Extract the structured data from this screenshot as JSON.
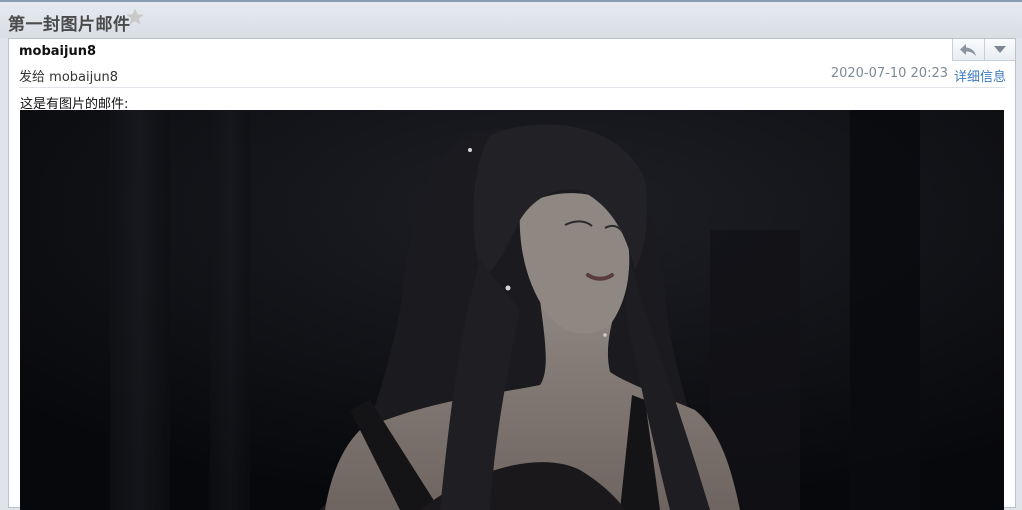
{
  "mail": {
    "subject": "第一封图片邮件",
    "sender": "mobaijun8",
    "to_label": "发给",
    "recipient": "mobaijun8",
    "date": "2020-07-10 20:23",
    "details_link": "详细信息",
    "body_text": "这是有图片的邮件:"
  },
  "icons": {
    "star": "star-icon",
    "reply": "reply-icon",
    "more": "dropdown-arrow-icon"
  },
  "colors": {
    "link": "#3b7bbf",
    "date": "#7f8a94",
    "star": "#c8c8c8"
  }
}
